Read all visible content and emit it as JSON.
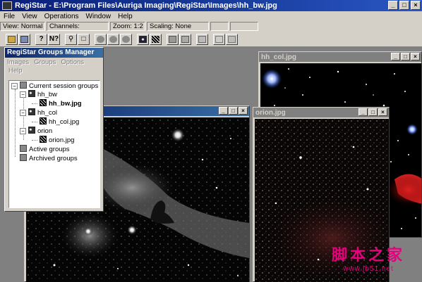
{
  "app": {
    "title": "RegiStar - E:\\Program Files\\Auriga Imaging\\RegiStar\\Images\\hh_bw.jpg",
    "min": "_",
    "max": "□",
    "close": "×"
  },
  "menu": [
    "File",
    "View",
    "Operations",
    "Window",
    "Help"
  ],
  "status": {
    "view": "View: Normal",
    "channels": "Channels:",
    "zoom": "Zoom: 1:2",
    "scaling": "Scaling: None"
  },
  "toolbar": {
    "tools": [
      "open-icon",
      "save-icon",
      "help-icon",
      "context-help-icon",
      "zoom-icon",
      "select-icon",
      "circle-1-icon",
      "circle-2-icon",
      "circle-3-icon",
      "stars-icon",
      "align-icon",
      "grid-icon",
      "register-icon",
      "combine-icon",
      "blend-icon",
      "chart-icon",
      "stack-icon"
    ]
  },
  "groups_manager": {
    "title": "RegiStar Groups Manager",
    "menu": [
      "Images",
      "Groups",
      "Options"
    ],
    "help": "Help",
    "tree": {
      "root": "Current session groups",
      "groups": [
        {
          "name": "hh_bw",
          "image": "hh_bw.jpg"
        },
        {
          "name": "hh_col",
          "image": "hh_col.jpg"
        },
        {
          "name": "orion",
          "image": "orion.jpg"
        }
      ],
      "active": "Active groups",
      "archived": "Archived groups"
    }
  },
  "windows": {
    "hh_col": {
      "title": "hh_col.jpg"
    },
    "orion": {
      "title": "orion.jpg"
    },
    "hh_bw": {
      "title": ""
    }
  },
  "watermark": {
    "main": "脚本之家",
    "sub": "www.jb51.net"
  }
}
